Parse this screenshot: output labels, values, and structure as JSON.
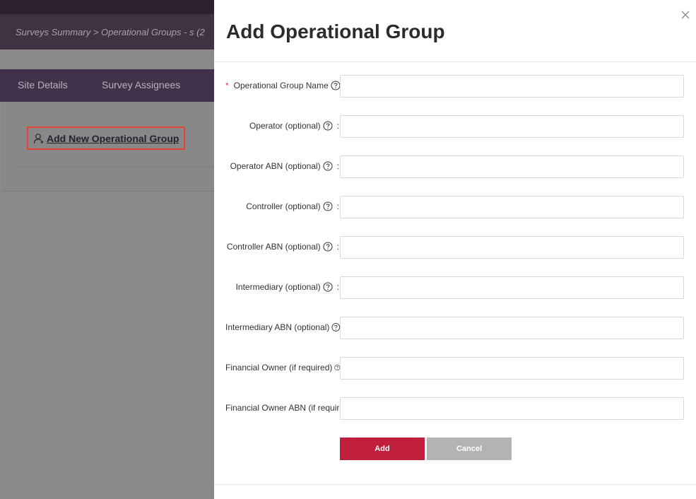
{
  "background": {
    "breadcrumb": "Surveys Summary > Operational Groups - s (2",
    "tabs": [
      "Site Details",
      "Survey Assignees"
    ],
    "add_link_label": "Add New Operational Group"
  },
  "modal": {
    "title": "Add Operational Group",
    "fields": [
      {
        "label": "Operational Group Name",
        "required": true,
        "value": ""
      },
      {
        "label": "Operator (optional)",
        "value": ""
      },
      {
        "label": "Operator ABN (optional)",
        "value": ""
      },
      {
        "label": "Controller (optional)",
        "value": ""
      },
      {
        "label": "Controller ABN (optional)",
        "value": ""
      },
      {
        "label": "Intermediary (optional)",
        "value": ""
      },
      {
        "label": "Intermediary ABN (optional)",
        "value": ""
      },
      {
        "label": "Financial Owner (if required)",
        "value": ""
      },
      {
        "label": "Financial Owner ABN (if required)",
        "value": ""
      }
    ],
    "required_marker": "*",
    "colon": ":",
    "add_label": "Add",
    "cancel_label": "Cancel"
  },
  "colors": {
    "accent": "#bf1e3c",
    "cancel": "#b3b3b3",
    "highlight": "#e2443a"
  },
  "icons": {
    "help": "question-circle-icon",
    "close": "close-icon",
    "add_user": "add-user-icon"
  }
}
